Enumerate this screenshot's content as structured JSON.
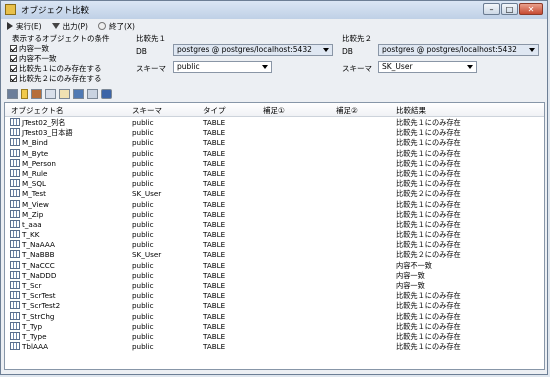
{
  "window": {
    "title": "オブジェクト比較"
  },
  "menu": {
    "execute": "実行(E)",
    "output": "出力(P)",
    "exit": "終了(X)"
  },
  "conditions": {
    "label": "表示するオブジェクトの条件",
    "items": [
      {
        "label": "内容一致",
        "checked": true
      },
      {
        "label": "内容不一致",
        "checked": true
      },
      {
        "label": "比較先１にのみ存在する",
        "checked": true
      },
      {
        "label": "比較先２にのみ存在する",
        "checked": true
      }
    ]
  },
  "target1": {
    "label": "比較先１",
    "db_label": "DB",
    "db_value": "postgres @ postgres/localhost:5432",
    "schema_label": "スキーマ",
    "schema_value": "public"
  },
  "target2": {
    "label": "比較先２",
    "db_label": "DB",
    "db_value": "postgres @ postgres/localhost:5432",
    "schema_label": "スキーマ",
    "schema_value": "SK_User"
  },
  "toolbar_icons": [
    "table-icon",
    "key-icon",
    "index-icon",
    "view-icon",
    "sequence-icon",
    "function-icon",
    "trigger-icon",
    "package-icon"
  ],
  "columns": [
    "オブジェクト名",
    "スキーマ",
    "タイプ",
    "補足①",
    "補足②",
    "比較結果"
  ],
  "rows": [
    [
      "JTest02_列名",
      "public",
      "TABLE",
      "",
      "",
      "比較先１にのみ存在"
    ],
    [
      "JTest03_日本語",
      "public",
      "TABLE",
      "",
      "",
      "比較先１にのみ存在"
    ],
    [
      "M_Bind",
      "public",
      "TABLE",
      "",
      "",
      "比較先１にのみ存在"
    ],
    [
      "M_Byte",
      "public",
      "TABLE",
      "",
      "",
      "比較先１にのみ存在"
    ],
    [
      "M_Person",
      "public",
      "TABLE",
      "",
      "",
      "比較先１にのみ存在"
    ],
    [
      "M_Rule",
      "public",
      "TABLE",
      "",
      "",
      "比較先１にのみ存在"
    ],
    [
      "M_SQL",
      "public",
      "TABLE",
      "",
      "",
      "比較先１にのみ存在"
    ],
    [
      "M_Test",
      "SK_User",
      "TABLE",
      "",
      "",
      "比較先２にのみ存在"
    ],
    [
      "M_View",
      "public",
      "TABLE",
      "",
      "",
      "比較先１にのみ存在"
    ],
    [
      "M_Zip",
      "public",
      "TABLE",
      "",
      "",
      "比較先１にのみ存在"
    ],
    [
      "t_aaa",
      "public",
      "TABLE",
      "",
      "",
      "比較先１にのみ存在"
    ],
    [
      "T_KK",
      "public",
      "TABLE",
      "",
      "",
      "比較先１にのみ存在"
    ],
    [
      "T_NaAAA",
      "public",
      "TABLE",
      "",
      "",
      "比較先１にのみ存在"
    ],
    [
      "T_NaBBB",
      "SK_User",
      "TABLE",
      "",
      "",
      "比較先２にのみ存在"
    ],
    [
      "T_NaCCC",
      "public",
      "TABLE",
      "",
      "",
      "内容不一致"
    ],
    [
      "T_NaDDD",
      "public",
      "TABLE",
      "",
      "",
      "内容一致"
    ],
    [
      "T_Scr",
      "public",
      "TABLE",
      "",
      "",
      "内容一致"
    ],
    [
      "T_ScrTest",
      "public",
      "TABLE",
      "",
      "",
      "比較先１にのみ存在"
    ],
    [
      "T_ScrTest2",
      "public",
      "TABLE",
      "",
      "",
      "比較先１にのみ存在"
    ],
    [
      "T_StrChg",
      "public",
      "TABLE",
      "",
      "",
      "比較先１にのみ存在"
    ],
    [
      "T_Typ",
      "public",
      "TABLE",
      "",
      "",
      "比較先１にのみ存在"
    ],
    [
      "T_Type",
      "public",
      "TABLE",
      "",
      "",
      "比較先１にのみ存在"
    ],
    [
      "TblAAA",
      "public",
      "TABLE",
      "",
      "",
      "比較先１にのみ存在"
    ]
  ]
}
